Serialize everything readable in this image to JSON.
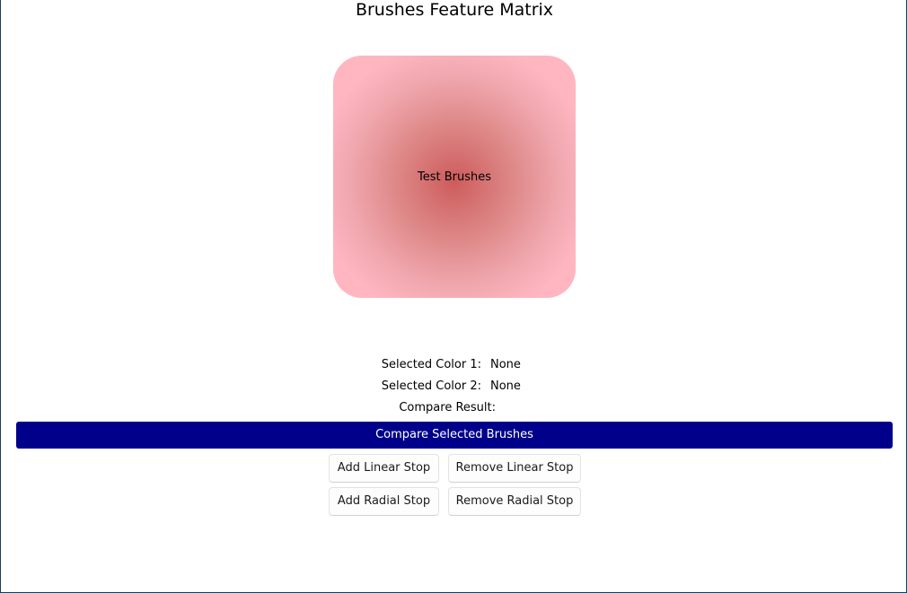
{
  "header": {
    "title": "Brushes Feature Matrix"
  },
  "preview": {
    "label": "Test Brushes",
    "colors": {
      "center": "#cd5c5c",
      "edge": "#ffb6c1"
    }
  },
  "info": {
    "color1_label": "Selected Color 1:",
    "color1_value": "None",
    "color2_label": "Selected Color 2:",
    "color2_value": "None",
    "compare_label": "Compare Result:",
    "compare_value": ""
  },
  "actions": {
    "compare_label": "Compare Selected Brushes",
    "compare_color": "#00008b",
    "add_linear_label": "Add Linear Stop",
    "remove_linear_label": "Remove Linear Stop",
    "add_radial_label": "Add Radial Stop",
    "remove_radial_label": "Remove Radial Stop"
  }
}
